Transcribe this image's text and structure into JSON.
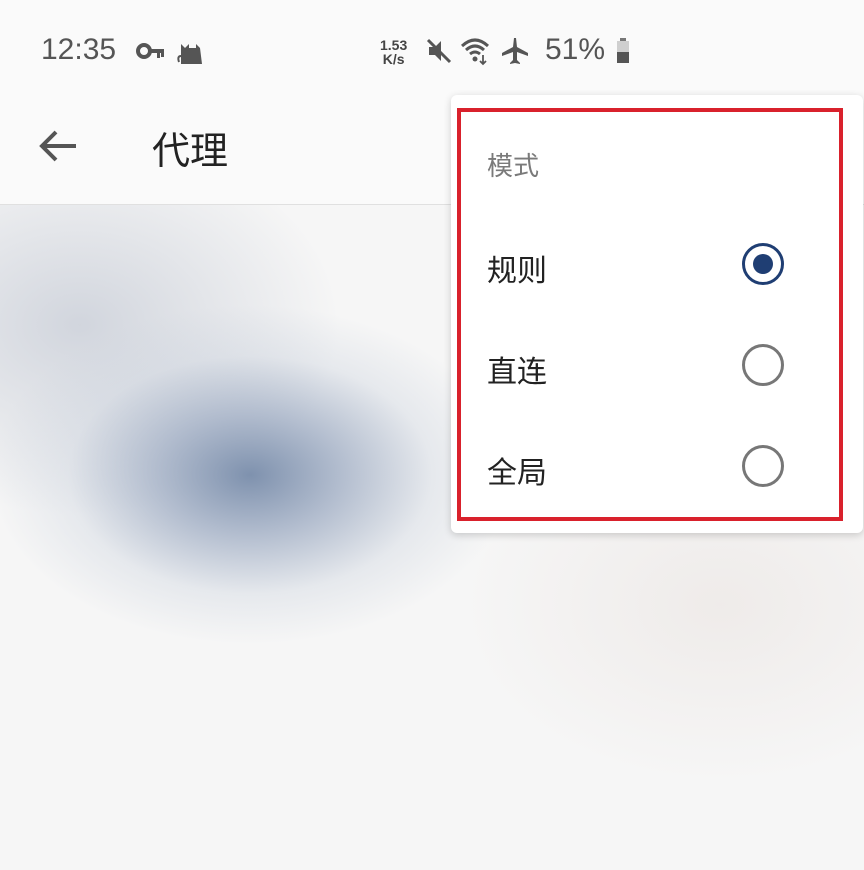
{
  "status_bar": {
    "time": "12:35",
    "speed_value": "1.53",
    "speed_unit": "K/s",
    "battery": "51%",
    "icons": [
      "vpn-key-icon",
      "cat-icon",
      "muted-icon",
      "wifi-icon",
      "airplane-icon",
      "battery-icon"
    ]
  },
  "app_bar": {
    "title": "代理",
    "back_icon": "arrow-left-icon"
  },
  "mode_menu": {
    "header": "模式",
    "options": [
      {
        "label": "规则",
        "selected": true
      },
      {
        "label": "直连",
        "selected": false
      },
      {
        "label": "全局",
        "selected": false
      }
    ],
    "accent_color": "#1f3e73",
    "highlight_color": "#d9212c"
  }
}
